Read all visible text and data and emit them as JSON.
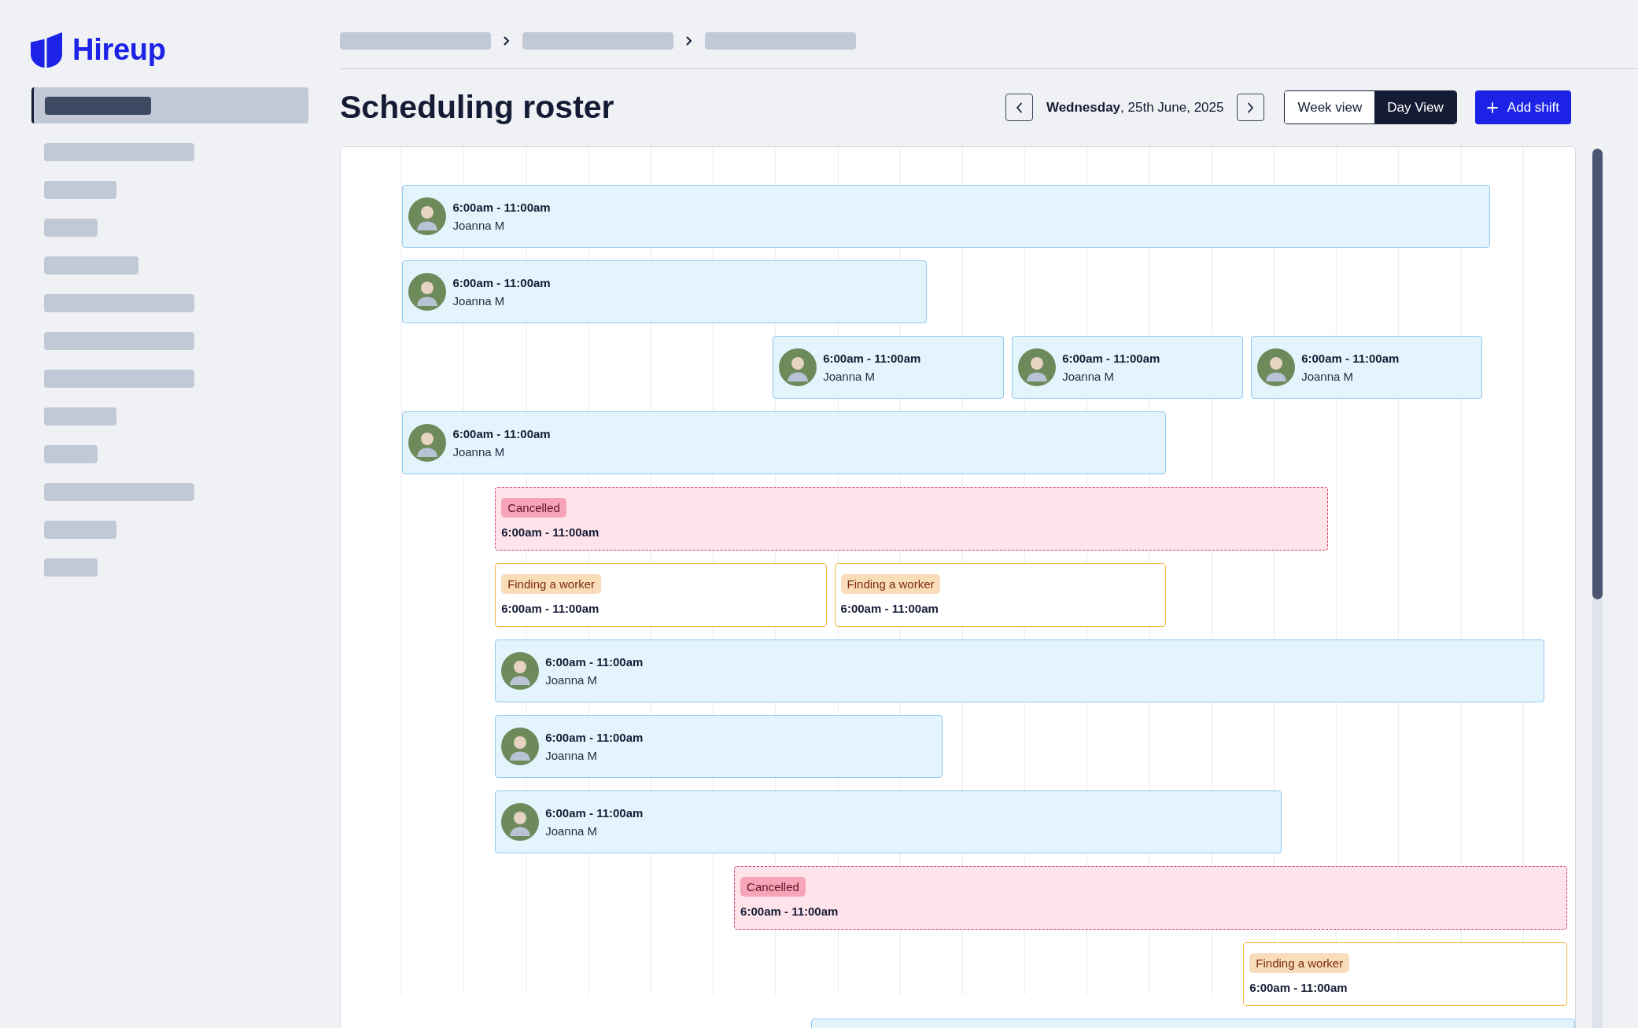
{
  "brand": {
    "name": "Hireup"
  },
  "sidebar": {
    "items": [
      {
        "kind": "wide",
        "selected": true
      },
      {
        "kind": "long",
        "selected": false
      },
      {
        "kind": "short",
        "selected": false
      },
      {
        "kind": "tiny",
        "selected": false
      },
      {
        "kind": "medium",
        "selected": false
      },
      {
        "kind": "long",
        "selected": false
      },
      {
        "kind": "long",
        "selected": false
      },
      {
        "kind": "long",
        "selected": false
      },
      {
        "kind": "short",
        "selected": false
      },
      {
        "kind": "tiny",
        "selected": false
      },
      {
        "kind": "long",
        "selected": false
      },
      {
        "kind": "short",
        "selected": false
      },
      {
        "kind": "tiny",
        "selected": false
      }
    ]
  },
  "breadcrumbs": [
    {
      "kind": "placeholder"
    },
    {
      "kind": "placeholder"
    },
    {
      "kind": "placeholder"
    }
  ],
  "page": {
    "title": "Scheduling roster"
  },
  "date_nav": {
    "date": "**Wednesday**, 25th June, 2025"
  },
  "view_toggle": [
    {
      "label": "Week view",
      "selected": false
    },
    {
      "label": "Day View",
      "selected": true
    }
  ],
  "add_button": {
    "label": "Add shift"
  },
  "roster": {
    "rows": [
      {
        "shifts": [
          {
            "kind": "assigned",
            "time": "6:00am - 11:00am",
            "worker": "Joanna M"
          }
        ]
      },
      {
        "shifts": [
          {
            "kind": "assigned",
            "time": "6:00am - 11:00am",
            "worker": "Joanna M"
          }
        ]
      },
      {
        "shifts": [
          {
            "kind": "assigned",
            "time": "6:00am - 11:00am",
            "worker": "Joanna M"
          },
          {
            "kind": "assigned",
            "time": "6:00am - 11:00am",
            "worker": "Joanna M"
          },
          {
            "kind": "assigned",
            "time": "6:00am - 11:00am",
            "worker": "Joanna M"
          }
        ]
      },
      {
        "shifts": [
          {
            "kind": "assigned",
            "time": "6:00am - 11:00am",
            "worker": "Joanna M"
          }
        ]
      },
      {
        "shifts": [
          {
            "kind": "cancelled",
            "status": "Cancelled",
            "time": "6:00am - 11:00am"
          }
        ]
      },
      {
        "shifts": [
          {
            "kind": "unfilled",
            "status": "Finding a worker",
            "time": "6:00am - 11:00am"
          },
          {
            "kind": "unfilled",
            "status": "Finding a worker",
            "time": "6:00am - 11:00am"
          }
        ]
      },
      {
        "shifts": [
          {
            "kind": "assigned",
            "time": "6:00am - 11:00am",
            "worker": "Joanna M"
          }
        ]
      },
      {
        "shifts": [
          {
            "kind": "assigned",
            "time": "6:00am - 11:00am",
            "worker": "Joanna M"
          }
        ]
      },
      {
        "shifts": [
          {
            "kind": "assigned",
            "time": "6:00am - 11:00am",
            "worker": "Joanna M"
          }
        ]
      },
      {
        "shifts": [
          {
            "kind": "cancelled",
            "status": "Cancelled",
            "time": "6:00am - 11:00am"
          }
        ]
      },
      {
        "shifts": [
          {
            "kind": "unfilled",
            "status": "Finding a worker",
            "time": "6:00am - 11:00am"
          }
        ]
      },
      {
        "shifts": [
          {
            "kind": "assigned"
          }
        ]
      }
    ]
  }
}
